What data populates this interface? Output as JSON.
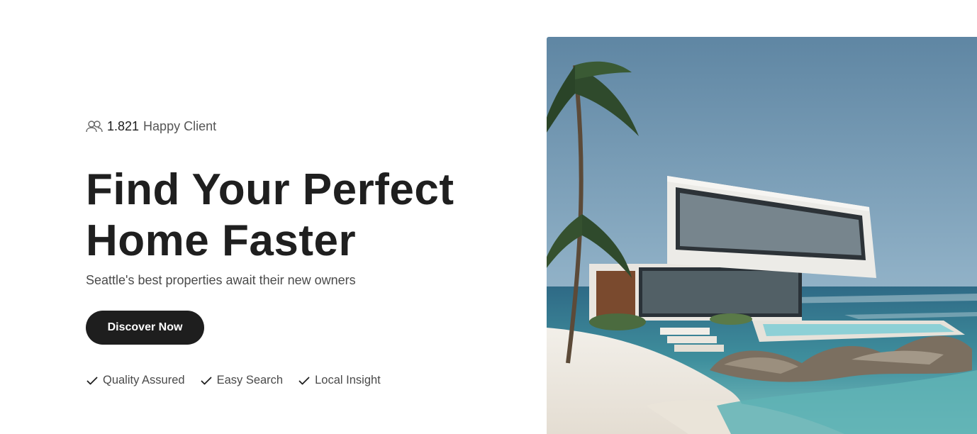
{
  "hero": {
    "client_count": "1.821",
    "client_label": "Happy Client",
    "client_icon": "users-icon",
    "headline_line1": "Find Your Perfect",
    "headline_line2": "Home Faster",
    "subtitle": "Seattle's best properties await their new owners",
    "cta_label": "Discover Now",
    "features": [
      {
        "label": "Quality Assured",
        "icon": "check-icon"
      },
      {
        "label": "Easy Search",
        "icon": "check-icon"
      },
      {
        "label": "Local Insight",
        "icon": "check-icon"
      }
    ]
  },
  "image": {
    "subject": "modern-beach-house-photo"
  },
  "colors": {
    "primary_text": "#1f1f1f",
    "muted_text": "#4a4a4a",
    "button_bg": "#1e1e1e",
    "button_text": "#ffffff",
    "background": "#ffffff"
  }
}
